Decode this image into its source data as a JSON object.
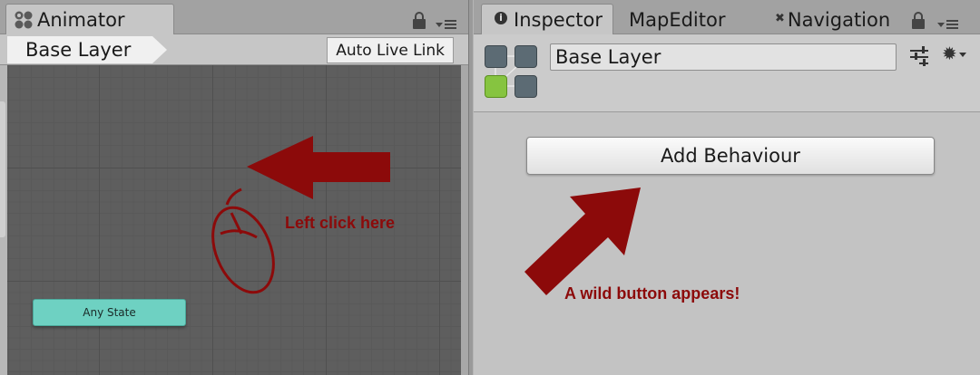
{
  "left_panel": {
    "tab": {
      "label": "Animator",
      "icon": "animator-icon"
    },
    "breadcrumb": "Base Layer",
    "live_link_label": "Auto Live Link",
    "state_node_label": "Any State"
  },
  "right_panel": {
    "tabs": [
      {
        "label": "Inspector",
        "icon": "info-icon"
      },
      {
        "label": "MapEditor"
      },
      {
        "label": "Navigation",
        "icon": "navigation-icon"
      }
    ],
    "layer_name_value": "Base Layer",
    "add_behaviour_label": "Add Behaviour"
  },
  "annotations": {
    "left_click_text": "Left click here",
    "wild_button_text": "A wild button appears!",
    "color": "#8c0a0a"
  },
  "colors": {
    "graph_background": "#5e5e5e",
    "state_node": "#6ed1c2",
    "panel": "#c3c3c3"
  }
}
